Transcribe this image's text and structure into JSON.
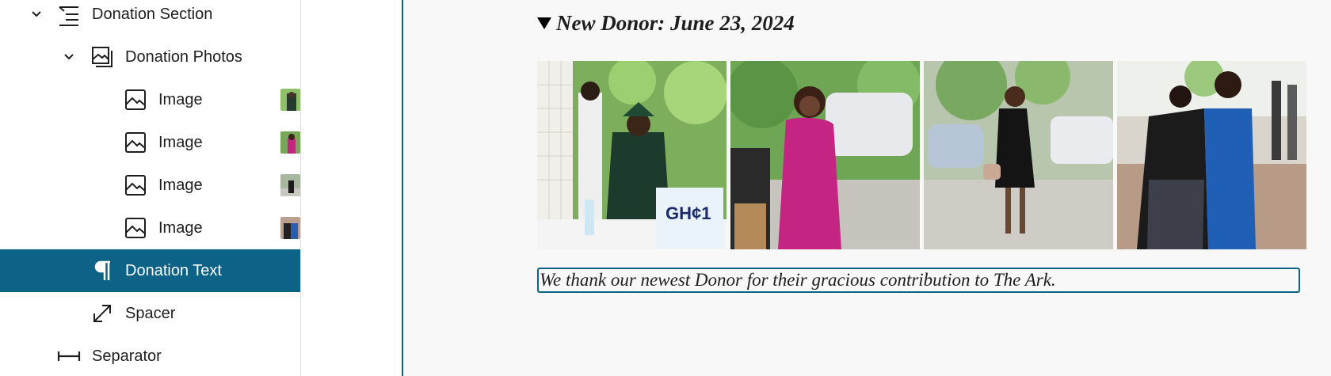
{
  "list_view": {
    "items": [
      {
        "label": "Donation Section",
        "icon": "group-icon",
        "expanded": true
      },
      {
        "label": "Donation Photos",
        "icon": "gallery-icon",
        "expanded": true
      },
      {
        "label": "Image",
        "icon": "image-icon"
      },
      {
        "label": "Image",
        "icon": "image-icon"
      },
      {
        "label": "Image",
        "icon": "image-icon"
      },
      {
        "label": "Image",
        "icon": "image-icon"
      },
      {
        "label": "Donation Text",
        "icon": "paragraph-icon",
        "selected": true
      },
      {
        "label": "Spacer",
        "icon": "resize-arrow-icon"
      },
      {
        "label": "Separator",
        "icon": "separator-icon"
      }
    ]
  },
  "canvas": {
    "summary": "New Donor: June 23, 2024",
    "gallery": [
      {
        "alt": "Officer in green uniform signing at donation desk"
      },
      {
        "alt": "Woman in pink dress"
      },
      {
        "alt": "Woman in black dress walking"
      },
      {
        "alt": "Two women hugging"
      }
    ],
    "paragraph": "We thank our newest Donor for their gracious contribution to The Ark."
  },
  "colors": {
    "accent": "#0c6287",
    "text": "#1e1e1e",
    "canvas_bg": "#f8f8f8"
  }
}
